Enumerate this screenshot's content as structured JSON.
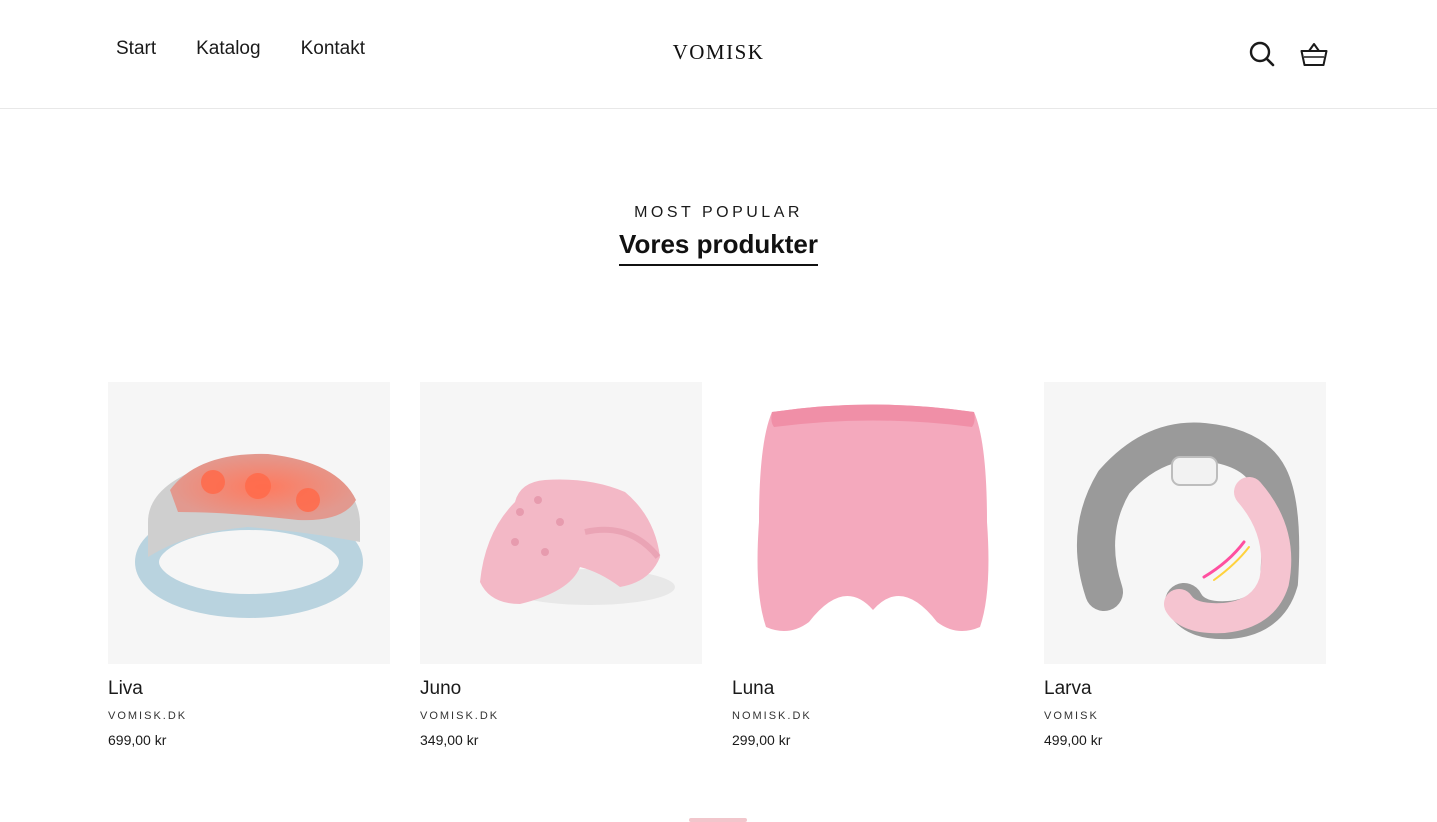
{
  "header": {
    "logo": "VOMISK",
    "nav": [
      {
        "label": "Start"
      },
      {
        "label": "Katalog"
      },
      {
        "label": "Kontakt"
      }
    ],
    "icons": {
      "search": "search-icon",
      "cart": "cart-icon"
    }
  },
  "section": {
    "eyebrow": "MOST POPULAR",
    "heading": "Vores produkter"
  },
  "products": [
    {
      "title": "Liva",
      "vendor": "VOMISK.DK",
      "price": "699,00 kr",
      "image": "waist-massager-belt"
    },
    {
      "title": "Juno",
      "vendor": "VOMISK.DK",
      "price": "349,00 kr",
      "image": "neck-stretcher-pillow"
    },
    {
      "title": "Luna",
      "vendor": "NOMISK.DK",
      "price": "299,00 kr",
      "image": "cooling-gel-head-mask"
    },
    {
      "title": "Larva",
      "vendor": "VOMISK",
      "price": "499,00 kr",
      "image": "neck-massager"
    }
  ],
  "colors": {
    "pink": "#f4a9bd",
    "accent_bar": "#f2c6cc",
    "text": "#1a1a1a"
  }
}
